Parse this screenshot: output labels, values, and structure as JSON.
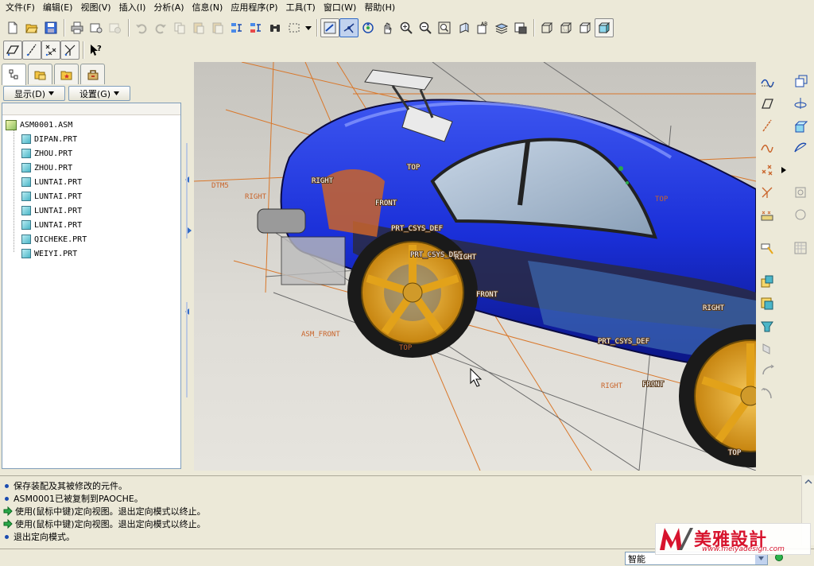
{
  "menu": [
    {
      "label": "文件(F)"
    },
    {
      "label": "编辑(E)"
    },
    {
      "label": "视图(V)"
    },
    {
      "label": "插入(I)"
    },
    {
      "label": "分析(A)"
    },
    {
      "label": "信息(N)"
    },
    {
      "label": "应用程序(P)"
    },
    {
      "label": "工具(T)"
    },
    {
      "label": "窗口(W)"
    },
    {
      "label": "帮助(H)"
    }
  ],
  "panel": {
    "show_label": "显示(D)",
    "settings_label": "设置(G)"
  },
  "model_tree": {
    "root": "ASM0001.ASM",
    "items": [
      "DIPAN.PRT",
      "ZHOU.PRT",
      "ZHOU.PRT",
      "LUNTAI.PRT",
      "LUNTAI.PRT",
      "LUNTAI.PRT",
      "LUNTAI.PRT",
      "QICHEKE.PRT",
      "WEIYI.PRT"
    ]
  },
  "viewport_labels": [
    "DTM5",
    "RIGHT",
    "ASM_FRONT",
    "TOP",
    "RIGHT",
    "FRONT",
    "TOP",
    "PRT_CSYS_DEF",
    "PRT_CSYS_DEF",
    "PRT_CSYS_DEF",
    "RIGHT",
    "FRONT",
    "TOP",
    "RIGHT",
    "RIGHT",
    "FRONT",
    "TOP"
  ],
  "messages": [
    {
      "type": "info",
      "text": "保存装配及其被修改的元件。"
    },
    {
      "type": "info",
      "text": "ASM0001已被复制到PAOCHE。"
    },
    {
      "type": "prompt",
      "text": "使用(鼠标中键)定向视图。退出定向模式以终止。"
    },
    {
      "type": "prompt",
      "text": "使用(鼠标中键)定向视图。退出定向模式以终止。"
    },
    {
      "type": "info",
      "text": "退出定向模式。"
    }
  ],
  "status": {
    "filter_value": "智能"
  },
  "watermark": {
    "text": "美雅設計",
    "url": "www.meiyadesign.com"
  },
  "colors": {
    "car_body": "#1a2fd8",
    "wheel_rim": "#e2a21a",
    "datum_plane": "#d9772a",
    "ui_bg": "#ece9d8"
  }
}
